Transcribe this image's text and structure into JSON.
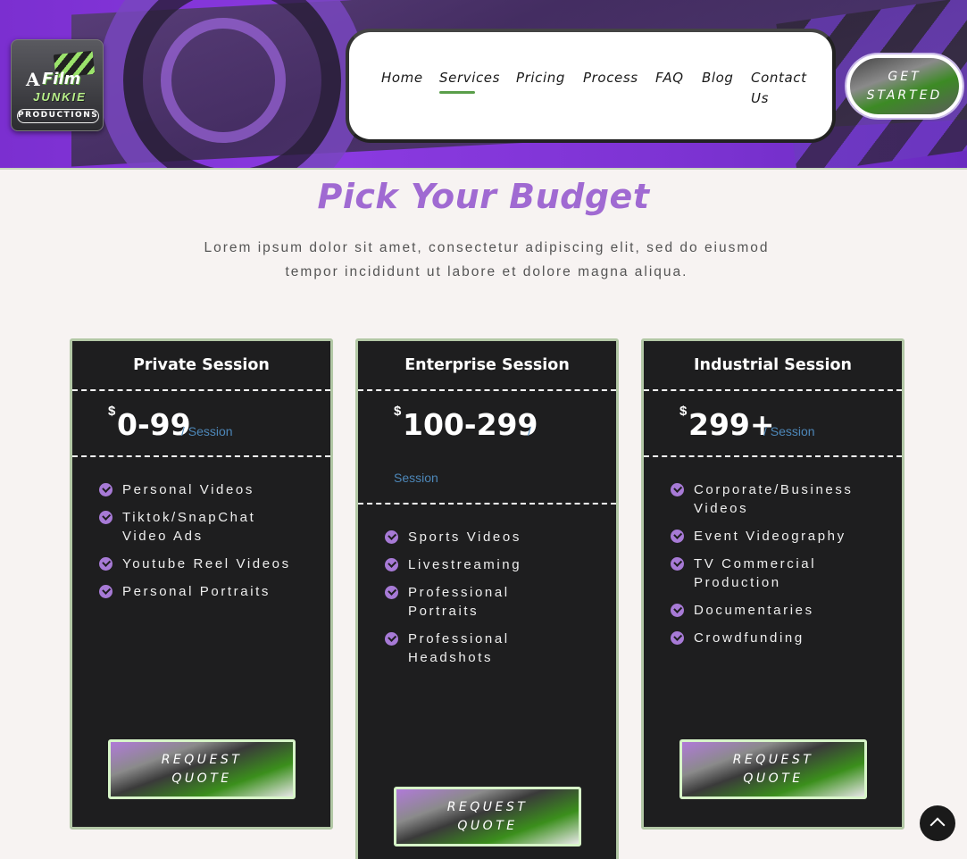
{
  "header": {
    "logo": {
      "letter_a": "A",
      "film": "Film",
      "junkie": "JUNKIE",
      "productions": "PRODUCTIONS"
    },
    "nav": [
      {
        "label": "Home",
        "active": false
      },
      {
        "label": "Services",
        "active": true
      },
      {
        "label": "Pricing",
        "active": false
      },
      {
        "label": "Process",
        "active": false
      },
      {
        "label": "FAQ",
        "active": false
      },
      {
        "label": "Blog",
        "active": false
      },
      {
        "label": "Contact",
        "label2": "Us",
        "active": false
      }
    ],
    "cta": {
      "line1": "GET",
      "line2": "STARTED"
    }
  },
  "pricing": {
    "title": "Pick Your Budget",
    "subtitle": "Lorem ipsum dolor sit amet, consectetur adipiscing elit, sed do eiusmod tempor incididunt ut labore et dolore magna aliqua.",
    "plans": [
      {
        "name": "Private Session",
        "currency": "$",
        "amount": "0-99",
        "per": "/ Session",
        "features": [
          "Personal Videos",
          "Tiktok/SnapChat Video Ads",
          "Youtube Reel Videos",
          "Personal Portraits"
        ],
        "button": {
          "line1": "REQUEST",
          "line2": "QUOTE"
        }
      },
      {
        "name": "Enterprise Session",
        "currency": "$",
        "amount": "100-299",
        "per_slash": "/",
        "per_word": "Session",
        "features": [
          "Sports Videos",
          "Livestreaming",
          "Professional Portraits",
          "Professional Headshots"
        ],
        "button": {
          "line1": "REQUEST",
          "line2": "QUOTE"
        }
      },
      {
        "name": "Industrial Session",
        "currency": "$",
        "amount": "299+",
        "per": "/ Session",
        "features": [
          "Corporate/Business Videos",
          "Event Videography",
          "TV Commercial Production",
          "Documentaries",
          "Crowdfunding"
        ],
        "button": {
          "line1": "REQUEST",
          "line2": "QUOTE"
        }
      }
    ]
  },
  "colors": {
    "accent_purple": "#a06ad2",
    "check_purple": "#a77ad6",
    "card_bg": "#1e1e1f",
    "card_border": "#b3c8a6",
    "period_blue": "#4d87b8"
  }
}
